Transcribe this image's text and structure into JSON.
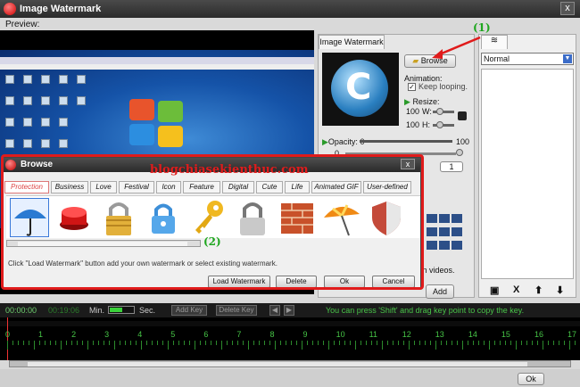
{
  "app": {
    "title": "Image Watermark",
    "close": "x"
  },
  "preview": {
    "label": "Preview:"
  },
  "wm_panel": {
    "tab": "Image Watermark",
    "browse": "Browse",
    "animation": "Animation:",
    "keep_looping": "Keep looping.",
    "resize": "Resize:",
    "w_value": "100",
    "w_label": "W:",
    "h_value": "100",
    "h_label": "H:",
    "opacity_label": "Opacity:",
    "opacity_min": "0",
    "opacity_max": "100",
    "opacity_value": "0",
    "times_value": "1",
    "videos_text": "ch videos.",
    "add": "Add"
  },
  "right_panel": {
    "select_value": "Normal",
    "tools": [
      "lock-icon",
      "delete-x",
      "up-arrow",
      "down-arrow"
    ],
    "x": "X"
  },
  "browse_dialog": {
    "title": "Browse",
    "close": "x",
    "tabs": [
      "Protection",
      "Business",
      "Love",
      "Festival",
      "Icon",
      "Feature",
      "Digital",
      "Cute",
      "Life",
      "Animated GIF",
      "User-defined"
    ],
    "hint": "Click \"Load Watermark\" button add your own watermark or select existing watermark.",
    "load": "Load Watermark",
    "delete": "Delete",
    "ok": "Ok",
    "cancel": "Cancel"
  },
  "overlay": {
    "site": "blogchiasekienthuc.com",
    "ann1": "(1)",
    "ann2": "(2)"
  },
  "timeline": {
    "start": "00:00:00",
    "end": "00:19:06",
    "min": "Min.",
    "sec": "Sec.",
    "add_key": "Add Key",
    "delete_key": "Delete Key",
    "hint": "You can press 'Shift' and drag key point to copy the key.",
    "ruler": [
      "0",
      "1",
      "2",
      "3",
      "4",
      "5",
      "6",
      "7",
      "8",
      "9",
      "10",
      "11",
      "12",
      "13",
      "14",
      "15",
      "16",
      "17"
    ]
  },
  "bottom": {
    "ok": "Ok"
  }
}
